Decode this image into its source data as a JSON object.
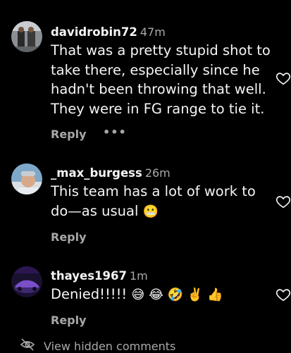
{
  "comments": [
    {
      "username": "davidrobin72",
      "time": "47m",
      "text": "That was a pretty stupid shot to take there, especially since he hadn't been throwing that well. They were in FG range to tie it.",
      "emoji": "",
      "reply": "Reply",
      "more": "•••"
    },
    {
      "username": "_max_burgess",
      "time": "26m",
      "text": "This team has a lot of work to do—as usual ",
      "emoji": "😬",
      "reply": "Reply"
    },
    {
      "username": "thayes1967",
      "time": "1m",
      "text": "Denied!!!!! ",
      "emoji": "😅 😂 🤣 ✌️ 👍",
      "reply": "Reply"
    }
  ],
  "footer": {
    "hidden_label": "View hidden comments"
  },
  "icons": {
    "like": "heart-outline-icon",
    "hidden": "eye-slash-icon",
    "more": "more-dots-icon"
  },
  "colors": {
    "background": "#000000",
    "primary_text": "#f5f5f5",
    "secondary_text": "#a8a8a8"
  }
}
